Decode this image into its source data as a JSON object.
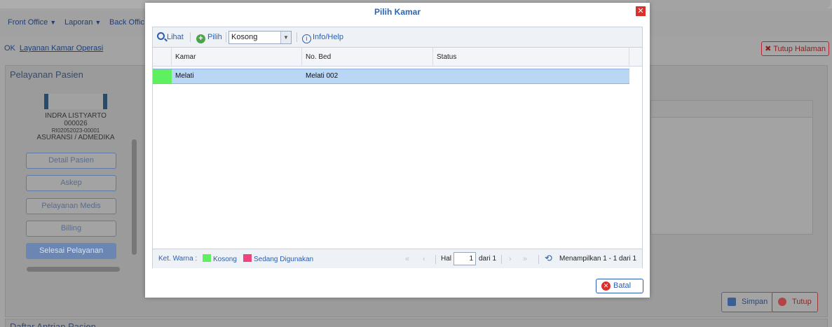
{
  "app": {
    "menu": [
      {
        "label": "Front Office"
      },
      {
        "label": "Laporan"
      },
      {
        "label": "Back Offic"
      }
    ],
    "breadcrumb": {
      "prefix": "OK",
      "link": "Layanan Kamar Operasi"
    },
    "close_page_label": "Tutup Halaman",
    "panel_title": "Pelayanan Pasien",
    "patient": {
      "name": "INDRA LISTYARTO",
      "number": "000026",
      "registration": "RI02052023-00001",
      "insurance": "ASURANSI / ADMEDIKA"
    },
    "side_buttons": [
      {
        "label": "Detail Pasien"
      },
      {
        "label": "Askep"
      },
      {
        "label": "Pelayanan Medis"
      },
      {
        "label": "Billing"
      },
      {
        "label": "Selesai Pelayanan"
      }
    ],
    "save_label": "Simpan",
    "close_label": "Tutup",
    "queue_panel_title": "Daftar Antrian Pasien"
  },
  "modal": {
    "title": "Pilih Kamar",
    "close_glyph": "✕",
    "toolbar": {
      "lihat_label": "Lihat",
      "pilih_label": "Pilih",
      "filter_value": "Kosong",
      "info_label": "Info/Help"
    },
    "columns": [
      "Kamar",
      "No. Bed",
      "Status"
    ],
    "rows": [
      {
        "kamar": "Melati",
        "bed": "Melati 002",
        "status": "",
        "color": "#5ef05e"
      }
    ],
    "footer": {
      "legend_label": "Ket. Warna :",
      "legend": [
        {
          "label": "Kosong",
          "color": "#5ef05e"
        },
        {
          "label": "Sedang Digunakan",
          "color": "#f0427f"
        }
      ],
      "page_label": "Hal",
      "page_value": "1",
      "page_total": "dari 1",
      "summary": "Menampilkan 1 - 1 dari 1"
    },
    "cancel_label": "Batal"
  }
}
